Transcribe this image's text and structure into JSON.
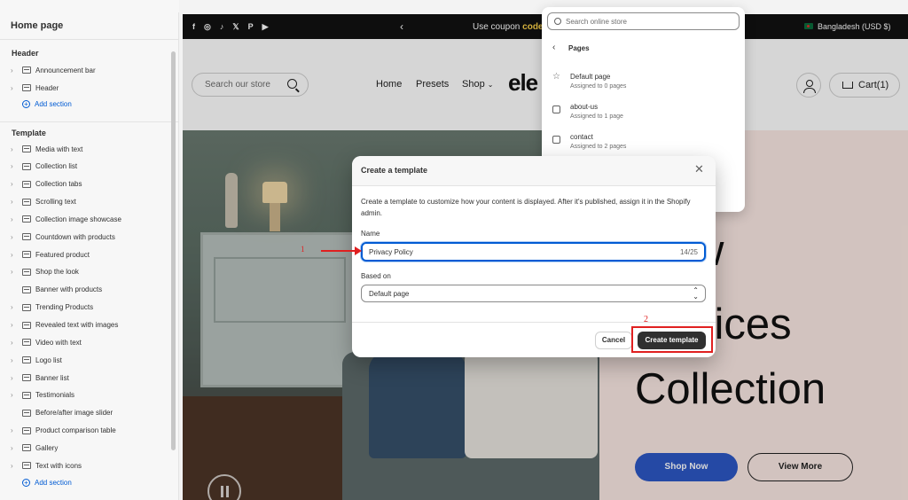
{
  "sidebar": {
    "title": "Home page",
    "header_group": "Header",
    "header_items": [
      "Announcement bar",
      "Header"
    ],
    "add_section": "Add section",
    "template_group": "Template",
    "template_items": [
      "Media with text",
      "Collection list",
      "Collection tabs",
      "Scrolling text",
      "Collection image showcase",
      "Countdown with products",
      "Featured product",
      "Shop the look",
      "Banner with products",
      "Trending Products",
      "Revealed text with images",
      "Video with text",
      "Logo list",
      "Banner list",
      "Testimonials",
      "Before/after image slider",
      "Product comparison table",
      "Gallery",
      "Text with icons"
    ],
    "add_section_2": "Add section"
  },
  "store": {
    "social": [
      "f",
      "◎",
      "♪",
      "𝕏",
      "P",
      "▶"
    ],
    "announcement_prefix": "Use coupon",
    "announcement_code": "code",
    "region": "Bangladesh (USD $)",
    "search_placeholder": "Search our store",
    "nav": [
      "Home",
      "Presets",
      "Shop"
    ],
    "shop_caret": "⌄",
    "logo": "ele",
    "cart": "Cart(1)",
    "hero_lines": [
      "w",
      "vices",
      "Collection"
    ],
    "shop_now": "Shop Now",
    "view_more": "View More"
  },
  "dropdown": {
    "search_placeholder": "Search online store",
    "back": "‹",
    "heading": "Pages",
    "items": [
      {
        "name": "Default page",
        "sub": "Assigned to 0 pages"
      },
      {
        "name": "about-us",
        "sub": "Assigned to 1 page"
      },
      {
        "name": "contact",
        "sub": "Assigned to 2 pages"
      }
    ]
  },
  "modal": {
    "title": "Create a template",
    "close": "✕",
    "description": "Create a template to customize how your content is displayed. After it's published, assign it in the Shopify admin.",
    "name_label": "Name",
    "name_value": "Privacy Policy",
    "char_count": "14/25",
    "based_on_label": "Based on",
    "based_on_value": "Default page",
    "cancel": "Cancel",
    "create": "Create template"
  },
  "annotations": {
    "step1": "1",
    "step2": "2"
  },
  "colors": {
    "accent": "#005bd3",
    "annotation": "#e02020",
    "primary_button": "#303030",
    "shop_now": "#2d57c5"
  }
}
